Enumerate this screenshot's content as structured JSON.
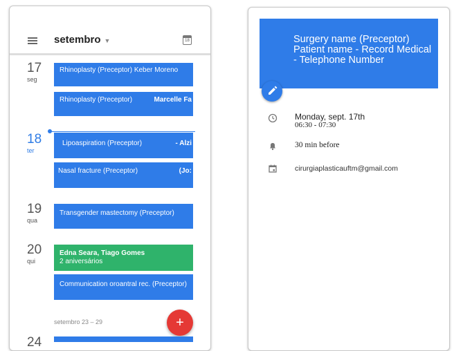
{
  "agenda": {
    "month_label": "setembro",
    "calendar_icon_day": "18",
    "days": [
      {
        "day": "17",
        "weekday": "seg"
      },
      {
        "day": "18",
        "weekday": "ter"
      },
      {
        "day": "19",
        "weekday": "qua"
      },
      {
        "day": "20",
        "weekday": "qui"
      }
    ],
    "events": [
      {
        "title": "Rhinoplasty (Preceptor) Keber Moreno",
        "extra": ""
      },
      {
        "title": "Rhinoplasty (Preceptor)",
        "extra": "Marcelle Fa"
      },
      {
        "title": "Lipoaspiration (Preceptor)",
        "extra": "- Alzi"
      },
      {
        "title": "Nasal fracture (Preceptor)",
        "extra": "(Jo:"
      },
      {
        "title": "Transgender mastectomy (Preceptor)",
        "extra": ""
      },
      {
        "title": "Edna Seara, Tiago Gomes",
        "subtitle": "2 aniversários"
      },
      {
        "title": "Communication oroantral rec. (Preceptor)",
        "extra": ""
      }
    ],
    "week_label": "setembro 23 – 29",
    "next_day_partial": "24",
    "fab_label": "+"
  },
  "detail": {
    "title": "Surgery name (Preceptor) Patient name - Record Medical - Telephone Number",
    "date_line": "Monday, sept. 17th",
    "time_line": "06:30 - 07:30",
    "reminder": "30 min before",
    "calendar_account": "cirurgiaplasticauftm@gmail.com"
  },
  "colors": {
    "event_blue": "#2f7ce8",
    "event_green": "#2fb36b",
    "fab_red": "#e53935",
    "today_blue": "#2d7be5"
  },
  "icons": [
    "menu-icon",
    "calendar-icon",
    "add-icon",
    "edit-icon",
    "clock-icon",
    "bell-icon",
    "calendar-account-icon"
  ]
}
